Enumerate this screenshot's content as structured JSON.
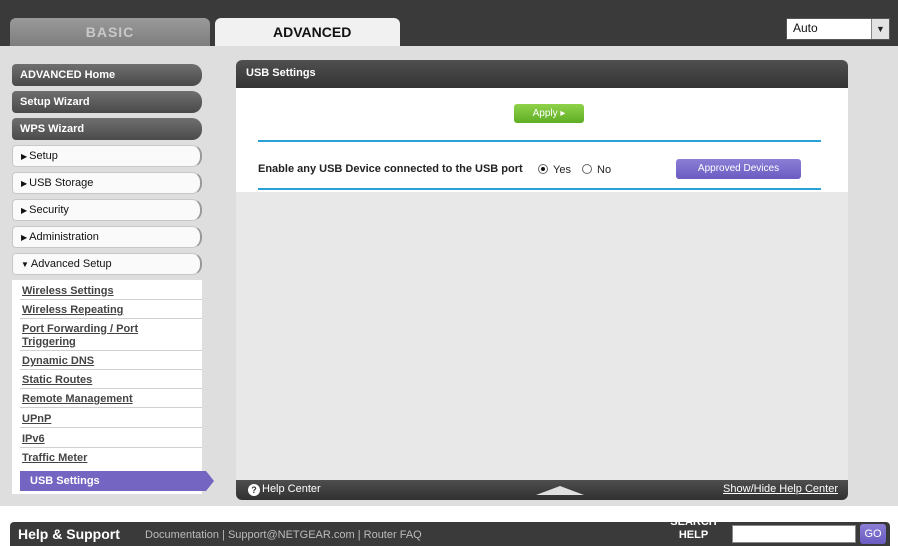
{
  "header": {
    "tab_basic": "BASIC",
    "tab_advanced": "ADVANCED",
    "language_selected": "Auto"
  },
  "sidebar": {
    "main_items": [
      {
        "label": "ADVANCED Home"
      },
      {
        "label": "Setup Wizard"
      },
      {
        "label": "WPS Wizard"
      }
    ],
    "sections": [
      {
        "label": "Setup"
      },
      {
        "label": "USB Storage"
      },
      {
        "label": "Security"
      },
      {
        "label": "Administration"
      },
      {
        "label": "Advanced Setup"
      }
    ],
    "advanced_setup_links": [
      {
        "label": "Wireless Settings"
      },
      {
        "label": "Wireless Repeating"
      },
      {
        "label": "Port Forwarding / Port"
      },
      {
        "label": "Triggering"
      },
      {
        "label": "Dynamic DNS"
      },
      {
        "label": "Static Routes"
      },
      {
        "label": "Remote Management"
      },
      {
        "label": "UPnP"
      },
      {
        "label": "IPv6"
      },
      {
        "label": "Traffic Meter"
      },
      {
        "label": "USB Settings"
      }
    ]
  },
  "panel": {
    "title": "USB Settings",
    "apply_label": "Apply ▸",
    "enable_usb_label": "Enable any USB Device connected to the USB port",
    "radio_yes": "Yes",
    "radio_no": "No",
    "radio_selected": "Yes",
    "approved_devices_label": "Approved Devices"
  },
  "helpbar": {
    "help_center_label": "Help Center",
    "show_hide_label": "Show/Hide Help Center"
  },
  "footer": {
    "help_support": "Help & Support",
    "links_text": "Documentation | Support@NETGEAR.com | Router FAQ",
    "search_help_label": "SEARCH HELP",
    "go_label": "GO"
  },
  "colors": {
    "purple_accent": "#7465c3",
    "green_apply": "#6dbb33",
    "blue_rule": "#2aa1d4",
    "dark_bar": "#3a3a3a"
  }
}
